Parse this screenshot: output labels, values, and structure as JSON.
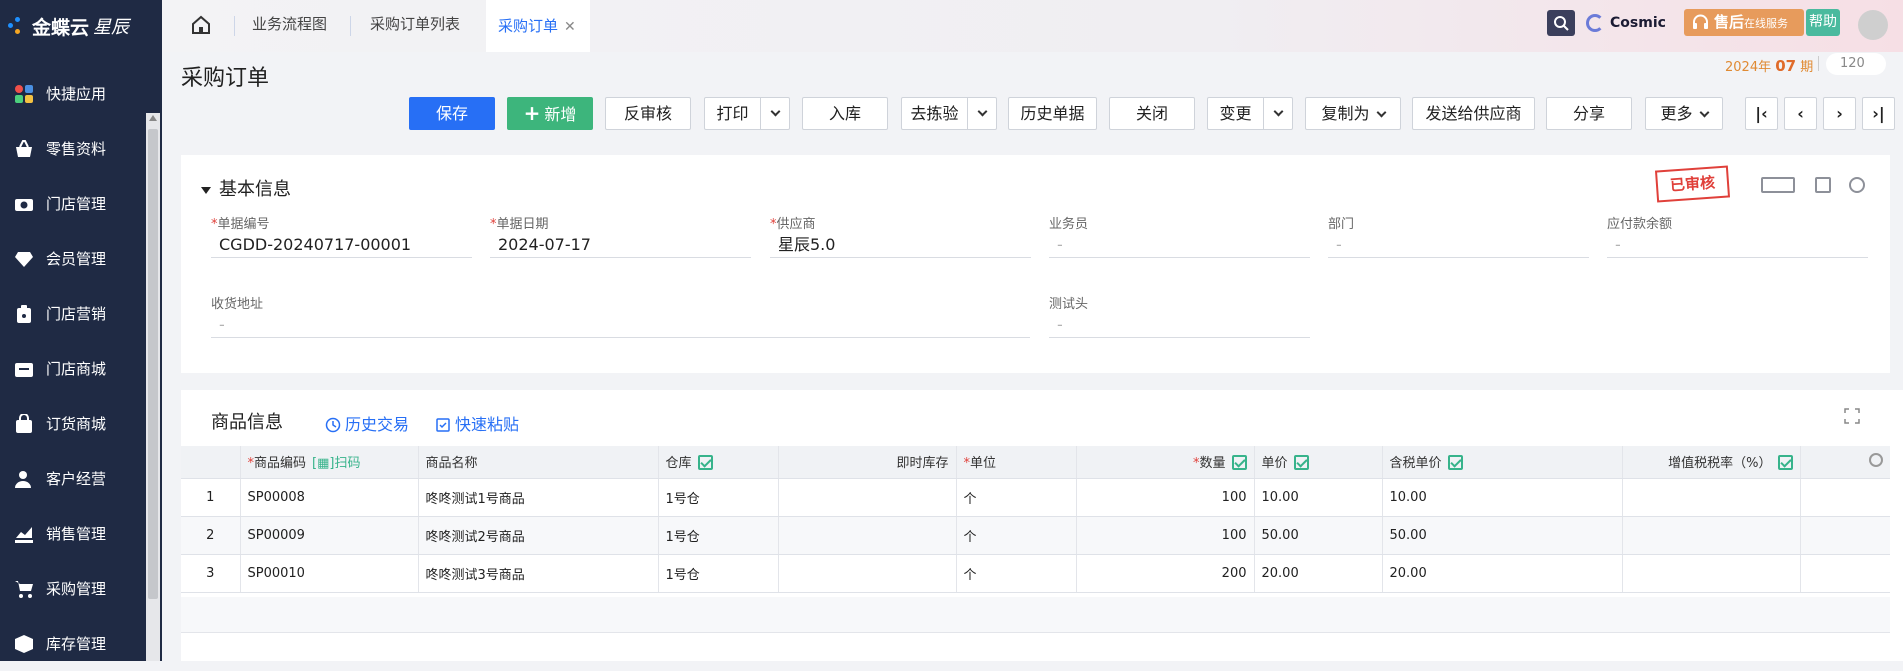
{
  "sidebar": {
    "brand": "金蝶云",
    "brand_sub": "星辰",
    "items": [
      {
        "label": "快捷应用",
        "icon": "apps-icon"
      },
      {
        "label": "零售资料",
        "icon": "basket-icon"
      },
      {
        "label": "门店管理",
        "icon": "store-camera-icon"
      },
      {
        "label": "会员管理",
        "icon": "diamond-icon"
      },
      {
        "label": "门店营销",
        "icon": "marketing-icon"
      },
      {
        "label": "门店商城",
        "icon": "shop-icon"
      },
      {
        "label": "订货商城",
        "icon": "order-bag-icon"
      },
      {
        "label": "客户经营",
        "icon": "customer-icon"
      },
      {
        "label": "销售管理",
        "icon": "sales-chart-icon"
      },
      {
        "label": "采购管理",
        "icon": "cart-icon"
      },
      {
        "label": "库存管理",
        "icon": "box-icon"
      }
    ]
  },
  "topbar": {
    "tabs": [
      {
        "label": "业务流程图"
      },
      {
        "label": "采购订单列表"
      },
      {
        "label": "采购订单",
        "active": true
      }
    ],
    "cosmic_label": "Cosmic",
    "service_label": "售后",
    "service_sub": "在线服务",
    "help_label": "帮助"
  },
  "header": {
    "title": "采购订单",
    "period_year": "2024年",
    "period_num": "07",
    "period_unit": "期",
    "zoom": "120"
  },
  "toolbar": {
    "save": "保存",
    "new": "新增",
    "unaudit": "反审核",
    "print": "打印",
    "stock_in": "入库",
    "inspect": "去拣验",
    "history": "历史单据",
    "close": "关闭",
    "change": "变更",
    "copy_as": "复制为",
    "send_supplier": "发送给供应商",
    "share": "分享",
    "more": "更多"
  },
  "basic_info": {
    "title": "基本信息",
    "stamp": "已审核",
    "fields": {
      "bill_no": {
        "label": "单据编号",
        "value": "CGDD-20240717-00001"
      },
      "bill_date": {
        "label": "单据日期",
        "value": "2024-07-17"
      },
      "supplier": {
        "label": "供应商",
        "value": "星辰5.0"
      },
      "salesman": {
        "label": "业务员",
        "value": "-"
      },
      "department": {
        "label": "部门",
        "value": "-"
      },
      "payable": {
        "label": "应付款余额",
        "value": "-"
      },
      "address": {
        "label": "收货地址",
        "value": "-"
      },
      "test_head": {
        "label": "测试头",
        "value": "-"
      }
    }
  },
  "goods": {
    "title": "商品信息",
    "history_trade": "历史交易",
    "quick_paste": "快速粘贴",
    "columns": {
      "code": "商品编码",
      "scan": "扫码",
      "name": "商品名称",
      "warehouse": "仓库",
      "stock": "即时库存",
      "unit": "单位",
      "qty": "数量",
      "price": "单价",
      "tax_price": "含税单价",
      "vat_rate": "增值税税率（%）"
    },
    "rows": [
      {
        "idx": "1",
        "code": "SP00008",
        "name": "咚咚测试1号商品",
        "warehouse": "1号仓",
        "stock": "",
        "unit": "个",
        "qty": "100",
        "price": "10.00",
        "tax_price": "10.00",
        "vat_rate": ""
      },
      {
        "idx": "2",
        "code": "SP00009",
        "name": "咚咚测试2号商品",
        "warehouse": "1号仓",
        "stock": "",
        "unit": "个",
        "qty": "100",
        "price": "50.00",
        "tax_price": "50.00",
        "vat_rate": ""
      },
      {
        "idx": "3",
        "code": "SP00010",
        "name": "咚咚测试3号商品",
        "warehouse": "1号仓",
        "stock": "",
        "unit": "个",
        "qty": "200",
        "price": "20.00",
        "tax_price": "20.00",
        "vat_rate": ""
      }
    ]
  }
}
